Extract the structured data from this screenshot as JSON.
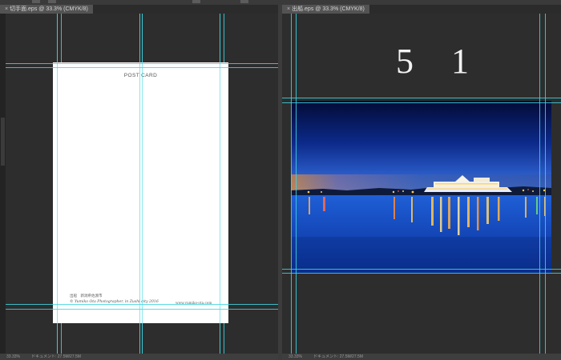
{
  "documents": [
    {
      "tab_title": "切手面.eps @ 33.3% (CMYK/8)",
      "close_glyph": "×",
      "status_zoom": "33.33%",
      "status_doc": "ドキュメント: 27.5M/27.5M",
      "postcard": {
        "title": "POST CARD",
        "caption_line1": "出船　新潟県佐渡市",
        "credit": "© Yumiko Ota Photographer, in Zushi city 2016",
        "website": "www.yumiko-ota.com"
      }
    },
    {
      "tab_title": "出船.eps @ 33.3% (CMYK/8)",
      "close_glyph": "×",
      "status_zoom": "33.33%",
      "status_doc": "ドキュメント: 27.5M/27.5M",
      "page_number": "5 1",
      "photo_icon": "night-harbor-ferry-photo"
    }
  ],
  "colors": {
    "guide": "#3fd5e3",
    "canvas": "#2d2d2d",
    "tab": "#535353"
  }
}
